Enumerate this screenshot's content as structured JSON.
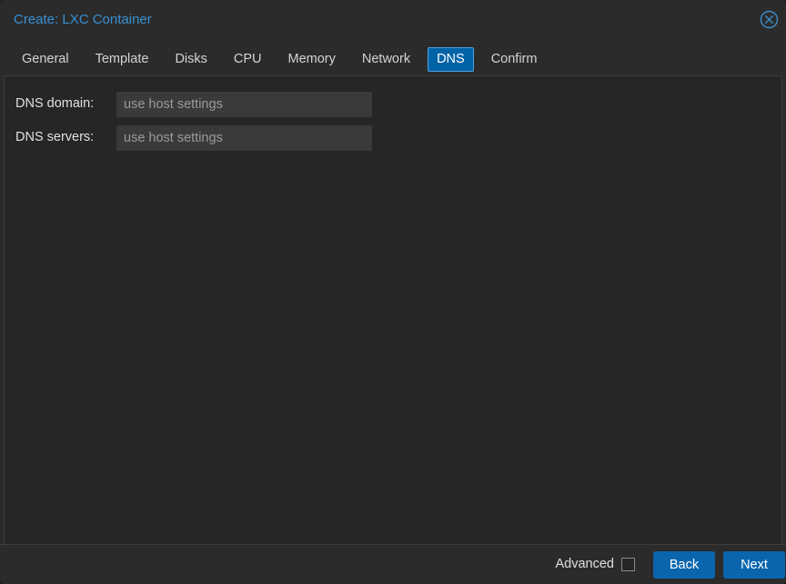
{
  "window": {
    "title": "Create: LXC Container",
    "close_icon": "close-circle-icon"
  },
  "tabs": [
    {
      "label": "General",
      "active": false
    },
    {
      "label": "Template",
      "active": false
    },
    {
      "label": "Disks",
      "active": false
    },
    {
      "label": "CPU",
      "active": false
    },
    {
      "label": "Memory",
      "active": false
    },
    {
      "label": "Network",
      "active": false
    },
    {
      "label": "DNS",
      "active": true
    },
    {
      "label": "Confirm",
      "active": false
    }
  ],
  "form": {
    "fields": [
      {
        "label": "DNS domain:",
        "value": "",
        "placeholder": "use host settings"
      },
      {
        "label": "DNS servers:",
        "value": "",
        "placeholder": "use host settings"
      }
    ]
  },
  "footer": {
    "advanced_label": "Advanced",
    "advanced_checked": false,
    "back_label": "Back",
    "next_label": "Next"
  },
  "colors": {
    "title_blue": "#3892d4",
    "accent_blue": "#0a65ad",
    "active_tab_bg": "#0063a6",
    "active_tab_border": "#4ea2de",
    "panel_bg": "#262626",
    "chrome_bg": "#2b2b2b",
    "input_bg": "#3a3a3a",
    "placeholder": "#9a9a9a"
  }
}
